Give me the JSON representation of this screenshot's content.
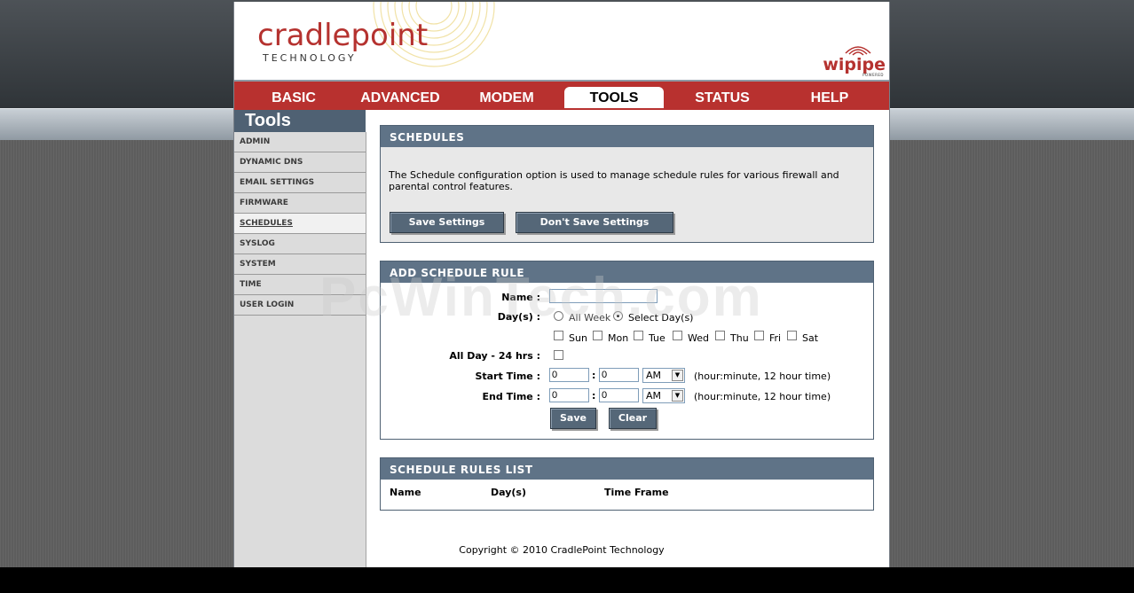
{
  "brand": {
    "name": "cradlepoint",
    "subtitle": "TECHNOLOGY",
    "partner": "wipipe",
    "partner_sub": "POWERED"
  },
  "nav": {
    "tabs": [
      {
        "label": "BASIC"
      },
      {
        "label": "ADVANCED"
      },
      {
        "label": "MODEM"
      },
      {
        "label": "TOOLS"
      },
      {
        "label": "STATUS"
      },
      {
        "label": "HELP"
      }
    ],
    "active": "TOOLS"
  },
  "sidebar": {
    "title": "Tools",
    "items": [
      {
        "label": "ADMIN"
      },
      {
        "label": "DYNAMIC DNS"
      },
      {
        "label": "EMAIL SETTINGS"
      },
      {
        "label": "FIRMWARE"
      },
      {
        "label": "SCHEDULES"
      },
      {
        "label": "SYSLOG"
      },
      {
        "label": "SYSTEM"
      },
      {
        "label": "TIME"
      },
      {
        "label": "USER LOGIN"
      }
    ],
    "current": "SCHEDULES"
  },
  "schedules": {
    "title": "SCHEDULES",
    "description": "The Schedule configuration option is used to manage schedule rules for various firewall and parental control features.",
    "save_label": "Save Settings",
    "dont_save_label": "Don't Save Settings"
  },
  "add_rule": {
    "title": "ADD SCHEDULE RULE",
    "name_label": "Name :",
    "name_value": "",
    "days_label": "Day(s) :",
    "all_week_label": "All Week",
    "select_days_label": "Select Day(s)",
    "days": [
      "Sun",
      "Mon",
      "Tue",
      "Wed",
      "Thu",
      "Fri",
      "Sat"
    ],
    "all_day_label": "All Day - 24 hrs :",
    "start_label": "Start Time :",
    "end_label": "End Time :",
    "start_hour": "0",
    "start_minute": "0",
    "start_ampm": "AM",
    "end_hour": "0",
    "end_minute": "0",
    "end_ampm": "AM",
    "colon": ":",
    "time_hint": "(hour:minute, 12 hour time)",
    "save_label": "Save",
    "clear_label": "Clear"
  },
  "rules_list": {
    "title": "SCHEDULE RULES LIST",
    "columns": [
      "Name",
      "Day(s)",
      "Time Frame"
    ]
  },
  "watermark": "PcWinTech.com",
  "copyright": "Copyright © 2010 CradlePoint Technology"
}
